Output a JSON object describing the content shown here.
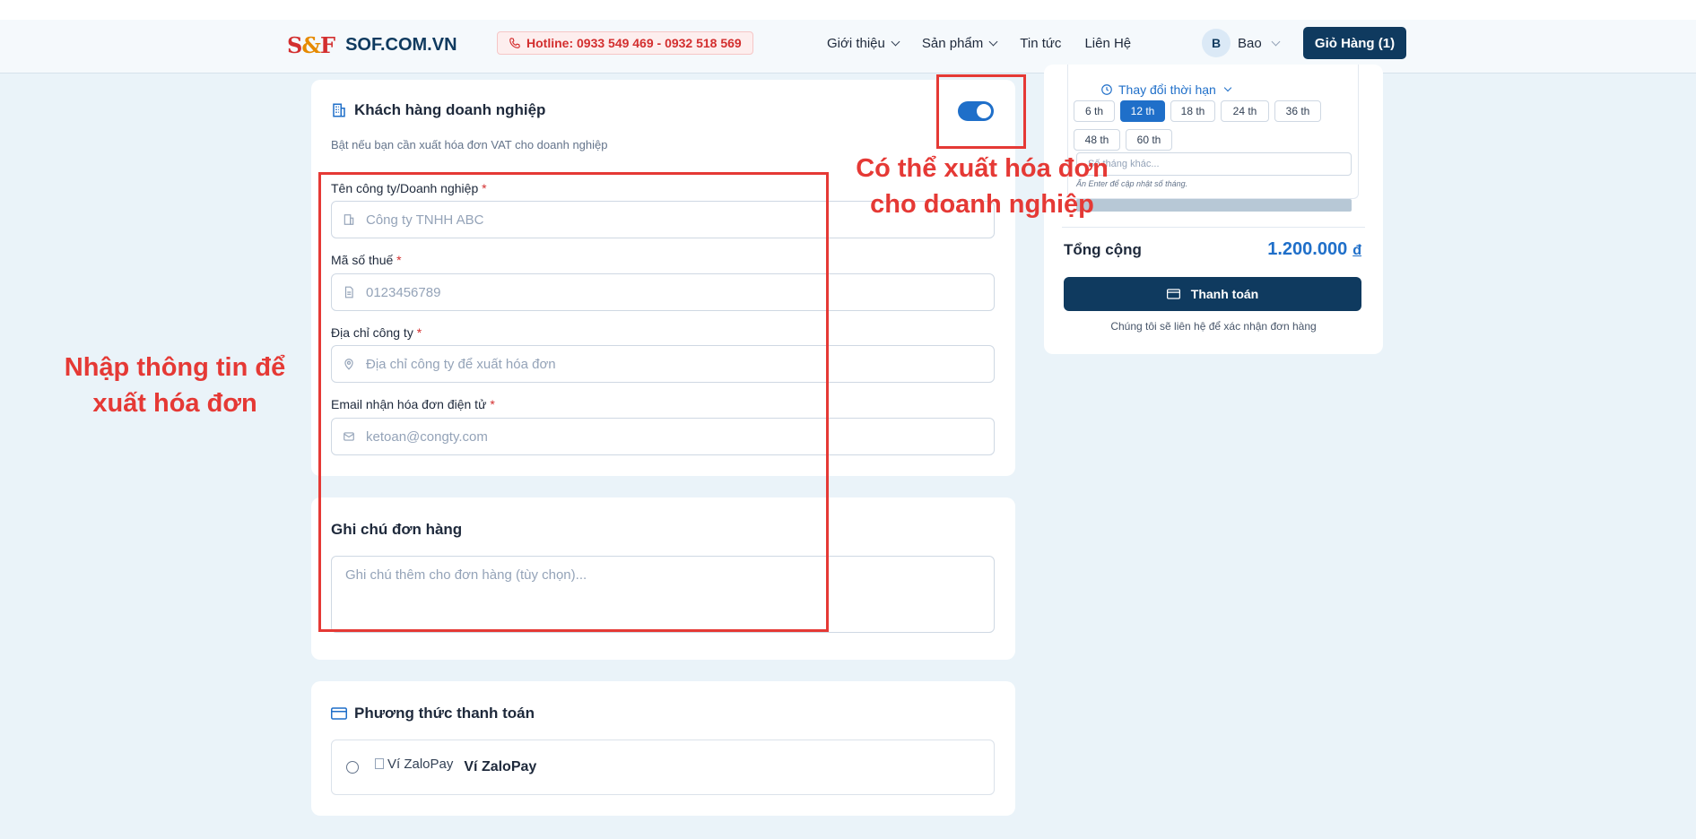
{
  "header": {
    "logo_mark": [
      "S",
      "&",
      "F"
    ],
    "brand": "SOF.COM.VN",
    "hotline": "Hotline: 0933 549 469 - 0932 518 569",
    "nav": [
      {
        "label": "Giới thiệu"
      },
      {
        "label": "Sản phẩm"
      },
      {
        "label": "Tin tức"
      },
      {
        "label": "Liên Hệ"
      }
    ],
    "user_initial": "B",
    "user_name": "Bao",
    "cart_label": "Giỏ Hàng (1)"
  },
  "business": {
    "title": "Khách hàng doanh nghiệp",
    "help": "Bật nếu bạn cần xuất hóa đơn VAT cho doanh nghiệp",
    "toggle_on": true,
    "fields": [
      {
        "label": "Tên công ty/Doanh nghiệp",
        "required": "*",
        "placeholder": "Công ty TNHH ABC",
        "icon": "building-icon"
      },
      {
        "label": "Mã số thuế",
        "required": "*",
        "placeholder": "0123456789",
        "icon": "document-icon"
      },
      {
        "label": "Địa chỉ công ty",
        "required": "*",
        "placeholder": "Địa chỉ công ty để xuất hóa đơn",
        "icon": "map-pin-icon"
      },
      {
        "label": "Email nhận hóa đơn điện tử",
        "required": "*",
        "placeholder": "ketoan@congty.com",
        "icon": "mail-icon"
      }
    ]
  },
  "notes": {
    "title": "Ghi chú đơn hàng",
    "placeholder": "Ghi chú thêm cho đơn hàng (tùy chọn)..."
  },
  "payment": {
    "title": "Phương thức thanh toán",
    "options": [
      {
        "img_alt": "Ví ZaloPay",
        "label": "Ví ZaloPay"
      }
    ]
  },
  "summary": {
    "change_term": "Thay đổi thời hạn",
    "terms": [
      "6 th",
      "12 th",
      "18 th",
      "24 th",
      "36 th",
      "48 th",
      "60 th"
    ],
    "active_term": "12 th",
    "custom_placeholder": "Số tháng khác...",
    "custom_hint": "Ấn Enter để cập nhật số tháng.",
    "total_label": "Tổng cộng",
    "total_value": "1.200.000",
    "currency": "đ",
    "checkout_label": "Thanh toán",
    "confirm_note": "Chúng tôi sẽ liên hệ để xác nhận đơn hàng"
  },
  "annotations": {
    "toggle_note": "Có thể xuất hóa đơn cho doanh nghiệp",
    "form_note": "Nhập thông tin để xuất hóa đơn"
  },
  "colors": {
    "primary": "#0f3a5f",
    "accent": "#1f6fc9",
    "annotation": "#e53935",
    "background": "#eaf3f9"
  }
}
